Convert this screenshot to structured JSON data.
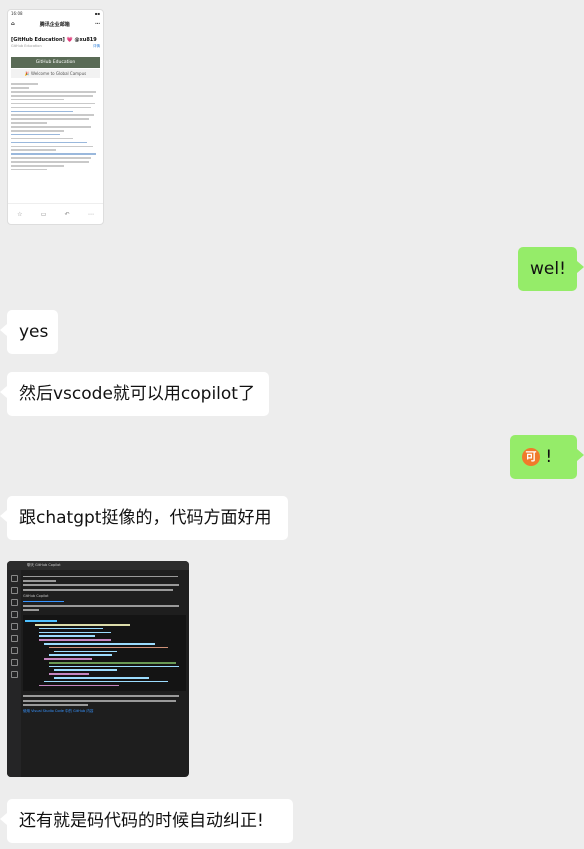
{
  "chat": {
    "messages": [
      {
        "side": "left",
        "kind": "image",
        "desc_key": "email-screenshot"
      },
      {
        "side": "right",
        "kind": "text",
        "text": "wel!"
      },
      {
        "side": "left",
        "kind": "text",
        "text": "yes"
      },
      {
        "side": "left",
        "kind": "text",
        "text": "然后vscode就可以用copilot了"
      },
      {
        "side": "right",
        "kind": "emoji-text",
        "emoji": "可",
        "text": "!"
      },
      {
        "side": "left",
        "kind": "text",
        "text": "跟chatgpt挺像的，代码方面好用"
      },
      {
        "side": "left",
        "kind": "image",
        "desc_key": "vscode-screenshot"
      },
      {
        "side": "left",
        "kind": "text",
        "text": "还有就是码代码的时候自动纠正!"
      }
    ]
  },
  "email_thumb": {
    "time": "16:08",
    "app_title": "腾讯企业邮箱",
    "subject": "[GitHub Education] 💗 @xu819",
    "sender": "GitHub Education",
    "detail_link": "详情",
    "banner": "GitHub Education",
    "welcome": "🎉 Welcome to Global Campus"
  },
  "vscode_thumb": {
    "window_title": "聊天 GitHub Copilot",
    "chat_header": "GitHub Copilot",
    "footer_link": "使用 Visual Studio Code 中的 GitHub 内容"
  }
}
